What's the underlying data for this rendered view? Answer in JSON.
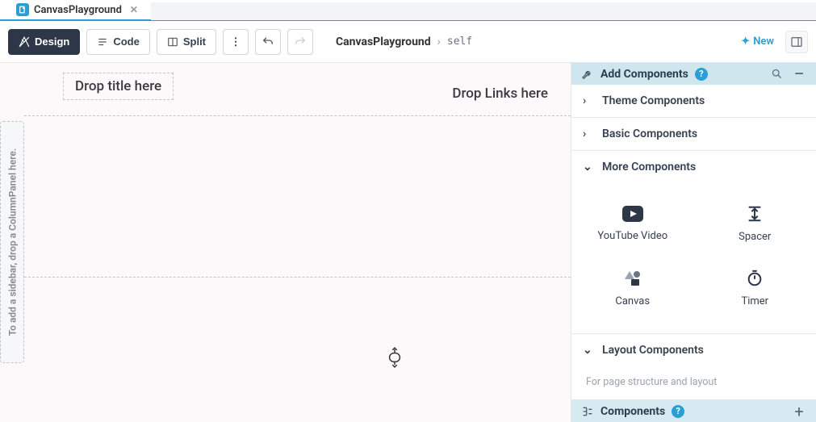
{
  "tab": {
    "title": "CanvasPlayground"
  },
  "toolbar": {
    "design": "Design",
    "code": "Code",
    "split": "Split",
    "breadcrumb_root": "CanvasPlayground",
    "breadcrumb_leaf": "self",
    "new": "New"
  },
  "canvas": {
    "title_placeholder": "Drop title here",
    "links_placeholder": "Drop Links here",
    "sidebar_hint": "To add a sidebar, drop a ColumnPanel here."
  },
  "panel": {
    "add_components_title": "Add Components",
    "sections": {
      "theme": "Theme Components",
      "basic": "Basic Components",
      "more": "More Components",
      "layout": "Layout Components",
      "layout_hint": "For page structure and layout"
    },
    "components": {
      "youtube": "YouTube Video",
      "spacer": "Spacer",
      "canvas": "Canvas",
      "timer": "Timer"
    },
    "bottom_title": "Components"
  }
}
